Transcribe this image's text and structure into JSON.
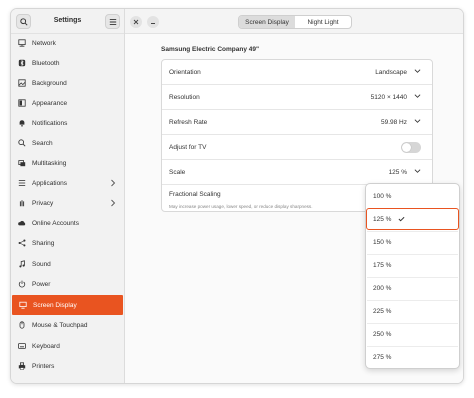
{
  "sidebar": {
    "title": "Settings",
    "items": [
      {
        "label": "Network",
        "icon": "network-icon"
      },
      {
        "label": "Bluetooth",
        "icon": "bluetooth-icon"
      },
      {
        "label": "Background",
        "icon": "background-icon"
      },
      {
        "label": "Appearance",
        "icon": "appearance-icon"
      },
      {
        "label": "Notifications",
        "icon": "bell-icon"
      },
      {
        "label": "Search",
        "icon": "search-icon"
      },
      {
        "label": "Multitasking",
        "icon": "multitasking-icon"
      },
      {
        "label": "Applications",
        "icon": "grid-icon"
      },
      {
        "label": "Privacy",
        "icon": "hand-icon"
      },
      {
        "label": "Online Accounts",
        "icon": "cloud-icon"
      },
      {
        "label": "Sharing",
        "icon": "share-icon"
      },
      {
        "label": "Sound",
        "icon": "music-note-icon"
      },
      {
        "label": "Power",
        "icon": "power-icon"
      },
      {
        "label": "Screen Display",
        "icon": "monitor-icon"
      },
      {
        "label": "Mouse & Touchpad",
        "icon": "mouse-icon"
      },
      {
        "label": "Keyboard",
        "icon": "keyboard-icon"
      },
      {
        "label": "Printers",
        "icon": "printer-icon"
      }
    ]
  },
  "tabs": [
    {
      "label": "Screen Display"
    },
    {
      "label": "Night Light"
    }
  ],
  "display": {
    "name": "Samsung Electric Company 49\"",
    "orientation_label": "Orientation",
    "orientation_value": "Landscape",
    "resolution_label": "Resolution",
    "resolution_value": "5120 × 1440",
    "refresh_label": "Refresh Rate",
    "refresh_value": "59.98 Hz",
    "adjust_tv_label": "Adjust for TV",
    "adjust_tv_on": false,
    "scale_label": "Scale",
    "scale_value": "125 %",
    "fractional_label": "Fractional Scaling",
    "fractional_desc": "May increase power usage, lower speed, or reduce display sharpness."
  },
  "scale_options": [
    "100 %",
    "125 %",
    "150 %",
    "175 %",
    "200 %",
    "225 %",
    "250 %",
    "275 %"
  ],
  "colors": {
    "accent": "#e95420",
    "toggle_off": "#d6d6d6"
  }
}
